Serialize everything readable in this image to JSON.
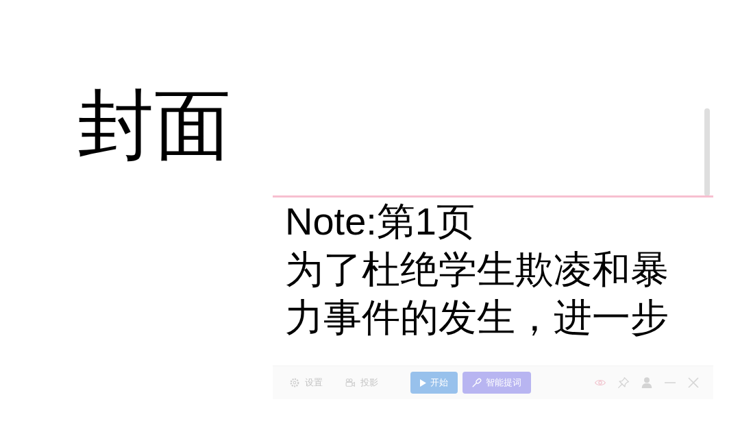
{
  "slide": {
    "title": "封面"
  },
  "prompter": {
    "heading": "Note:第1页",
    "text": "为了杜绝学生欺凌和暴力事件的发生，进一步"
  },
  "toolbar": {
    "tools": [
      {
        "kind": "settings",
        "label": "设置"
      },
      {
        "kind": "projection",
        "label": "投影"
      }
    ],
    "buttons": [
      {
        "kind": "start",
        "label": "开始"
      },
      {
        "kind": "smart",
        "label": "智能提词"
      }
    ]
  }
}
